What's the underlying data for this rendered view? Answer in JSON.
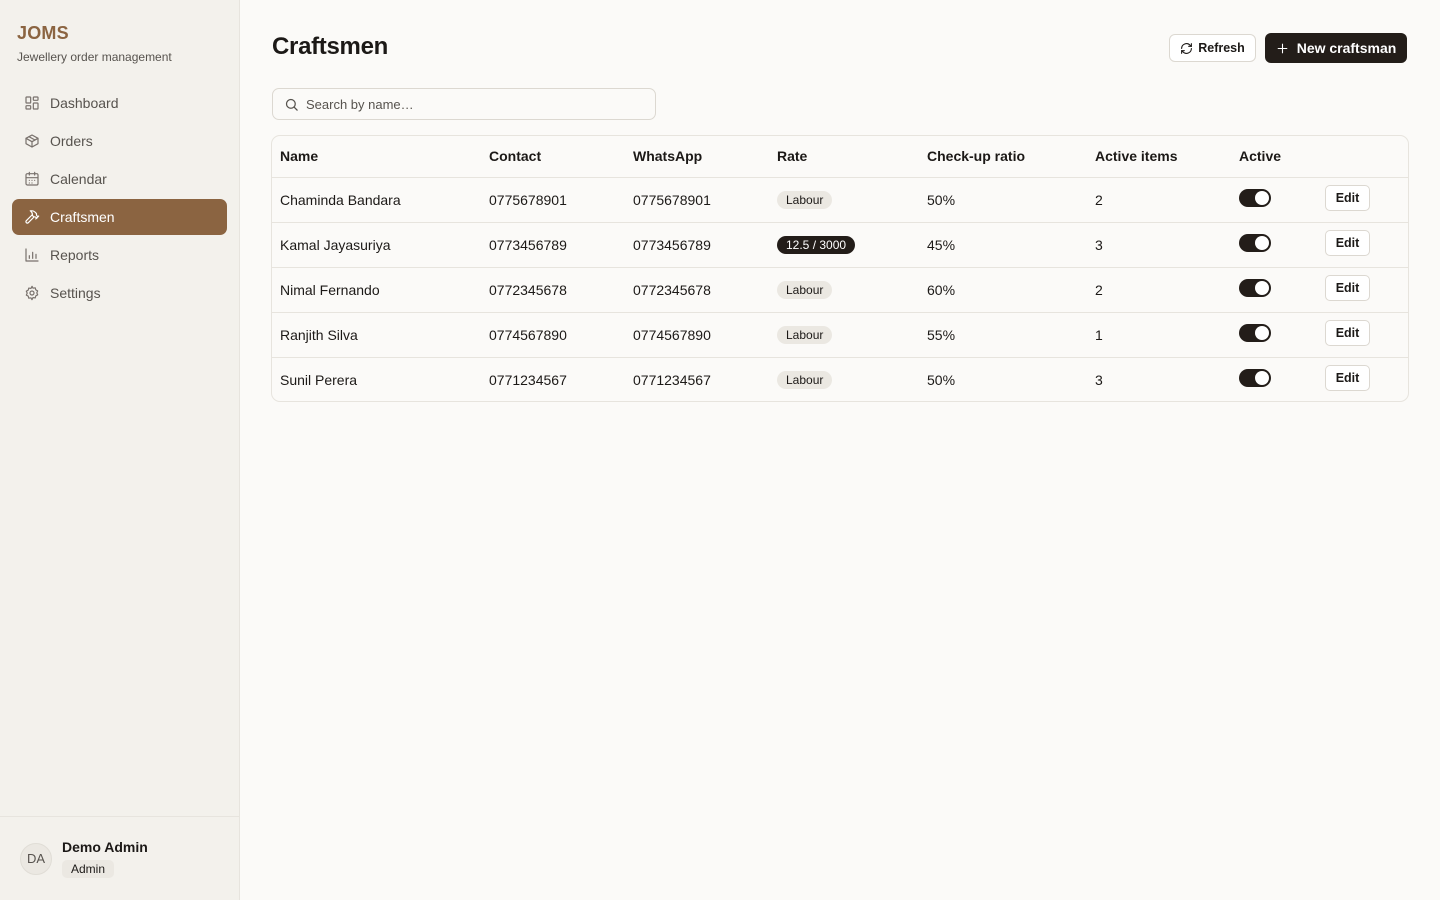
{
  "sidebar": {
    "brand_title": "JOMS",
    "brand_subtitle": "Jewellery order management",
    "items": [
      {
        "label": "Dashboard",
        "icon": "dashboard-icon"
      },
      {
        "label": "Orders",
        "icon": "package-icon"
      },
      {
        "label": "Calendar",
        "icon": "calendar-icon"
      },
      {
        "label": "Craftsmen",
        "icon": "hammer-icon",
        "active": true
      },
      {
        "label": "Reports",
        "icon": "bar-chart-icon"
      },
      {
        "label": "Settings",
        "icon": "gear-icon"
      }
    ],
    "user": {
      "initials": "DA",
      "name": "Demo Admin",
      "role": "Admin"
    }
  },
  "header": {
    "title": "Craftsmen",
    "refresh_label": "Refresh",
    "new_label": "New craftsman"
  },
  "search": {
    "placeholder": "Search by name…",
    "value": ""
  },
  "table": {
    "columns": [
      "Name",
      "Contact",
      "WhatsApp",
      "Rate",
      "Check-up ratio",
      "Active items",
      "Active",
      ""
    ],
    "rows": [
      {
        "name": "Chaminda Bandara",
        "contact": "0775678901",
        "whatsapp": "0775678901",
        "rate": "Labour",
        "rate_dark": false,
        "ratio": "50%",
        "active_items": "2",
        "active": true,
        "edit": "Edit"
      },
      {
        "name": "Kamal Jayasuriya",
        "contact": "0773456789",
        "whatsapp": "0773456789",
        "rate": "12.5 / 3000",
        "rate_dark": true,
        "ratio": "45%",
        "active_items": "3",
        "active": true,
        "edit": "Edit"
      },
      {
        "name": "Nimal Fernando",
        "contact": "0772345678",
        "whatsapp": "0772345678",
        "rate": "Labour",
        "rate_dark": false,
        "ratio": "60%",
        "active_items": "2",
        "active": true,
        "edit": "Edit"
      },
      {
        "name": "Ranjith Silva",
        "contact": "0774567890",
        "whatsapp": "0774567890",
        "rate": "Labour",
        "rate_dark": false,
        "ratio": "55%",
        "active_items": "1",
        "active": true,
        "edit": "Edit"
      },
      {
        "name": "Sunil Perera",
        "contact": "0771234567",
        "whatsapp": "0771234567",
        "rate": "Labour",
        "rate_dark": false,
        "ratio": "50%",
        "active_items": "3",
        "active": true,
        "edit": "Edit"
      }
    ]
  },
  "colors": {
    "accent": "#8b6441",
    "dark": "#231d19",
    "background": "#fbfaf8",
    "sidebar": "#f3f1ec"
  }
}
